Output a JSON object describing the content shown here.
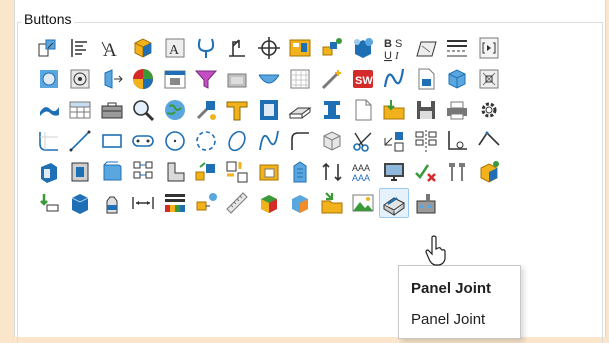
{
  "group": {
    "title": "Buttons"
  },
  "icons": [
    "new-part-icon",
    "left-align-icon",
    "text-style-icon",
    "3d-box-icon",
    "annotation-text-icon",
    "curve-u-icon",
    "crane-icon",
    "crosshair-icon",
    "layout-sheet-icon",
    "blocks-plug-icon",
    "balloons-icon",
    "bold-italic-icon",
    "planar-sheet-icon",
    "hatch-lines-icon",
    "bracket-view-icon",
    "cylinder-view-icon",
    "circle-target-icon",
    "move-face-icon",
    "color-wheel-icon",
    "window-photo-icon",
    "funnel-filter-icon",
    "gray-panel-icon",
    "dish-icon",
    "grid-sheet-icon",
    "magic-wand-icon",
    "solidworks-logo-icon",
    "blue-curve-icon",
    "document-save-icon",
    "cube-view-icon",
    "stencil-icon",
    "blue-flag-icon",
    "table-icon",
    "toolbox-icon",
    "magnifier-icon",
    "globe-icon",
    "tool-drop-icon",
    "t-beam-icon",
    "profile-frame-icon",
    "shelf-icon",
    "tall-profile-icon",
    "blank-page-icon",
    "arrow-folder-icon",
    "floppy-disk-icon",
    "printer-icon",
    "gear-icon",
    "sketch-corner-icon",
    "line-icon",
    "rectangle-icon",
    "slot-icon",
    "circle-icon",
    "dashed-arc-icon",
    "ellipse-icon",
    "spline-icon",
    "fillet-corner-icon",
    "box-shell-icon",
    "scissors-icon",
    "arrow-grid-icon",
    "mirror-pattern-icon",
    "base-line-icon",
    "corner-arrow-icon",
    "hole-wizard-icon",
    "brick-face-icon",
    "curved-panel-icon",
    "hinge-grid-icon",
    "boot-shape-icon",
    "blocks-arrow-icon",
    "bracket-grid-icon",
    "folder-sheet-icon",
    "building-icon",
    "swap-arrows-icon",
    "aaa-text-icon",
    "monitor-icon",
    "check-cross-icon",
    "bolt-pair-icon",
    "cube-yellow-icon",
    "arrow-stack-icon",
    "solid-cube-icon",
    "bottle-icon",
    "dimension-arrows-icon",
    "color-bars-icon",
    "plug-cube-icon",
    "ruler-icon",
    "colorful-shape-icon",
    "gradient-box-icon",
    "green-arrow-folder-icon",
    "landscape-icon",
    "panel-joint-icon",
    "factory-icon"
  ],
  "tooltip": {
    "title": "Panel Joint",
    "description": "Panel Joint"
  }
}
